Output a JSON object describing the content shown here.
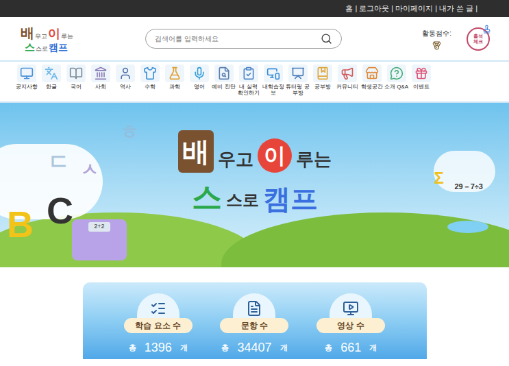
{
  "top_links": [
    "홈",
    "로그아웃",
    "마이페이지",
    "내가 쓴 글"
  ],
  "separator": "|",
  "logo": {
    "line1": [
      "배",
      "우고",
      "이",
      "루는"
    ],
    "line2": [
      "스",
      "스로",
      "캠프"
    ]
  },
  "search": {
    "placeholder": "검색어를 입력하세요"
  },
  "activity": {
    "label": "활동점수:"
  },
  "attendance": {
    "label": "출석체크"
  },
  "nav": [
    {
      "label": "공지사항"
    },
    {
      "label": "한글"
    },
    {
      "label": "국어"
    },
    {
      "label": "사회"
    },
    {
      "label": "역사"
    },
    {
      "label": "수학"
    },
    {
      "label": "과학"
    },
    {
      "label": "영어"
    },
    {
      "label": "예비 진단"
    },
    {
      "label": "내 실력 확인하기"
    },
    {
      "label": "내학습정보"
    },
    {
      "label": "튜터링 공부방"
    },
    {
      "label": "공부방"
    },
    {
      "label": "커뮤니티"
    },
    {
      "label": "학생공간"
    },
    {
      "label": "소개 Q&A"
    },
    {
      "label": "이벤트"
    }
  ],
  "banner": {
    "title_line1": [
      "배",
      "우고",
      "이",
      "루는"
    ],
    "title_line2": [
      "스",
      "스로",
      "캠프"
    ],
    "decor": {
      "hangul1": "ㅎ",
      "hangul2": "ㄷ",
      "hangul3": "ㅅ",
      "letter1": "B",
      "letter2": "C",
      "formula": "29－7÷3",
      "sigma": "Σ",
      "calc": "2+2"
    }
  },
  "stats": [
    {
      "label": "학습 요소 수",
      "prefix": "총",
      "value": "1396",
      "unit": "개"
    },
    {
      "label": "문항 수",
      "prefix": "총",
      "value": "34407",
      "unit": "개"
    },
    {
      "label": "영상 수",
      "prefix": "총",
      "value": "661",
      "unit": "개"
    }
  ]
}
